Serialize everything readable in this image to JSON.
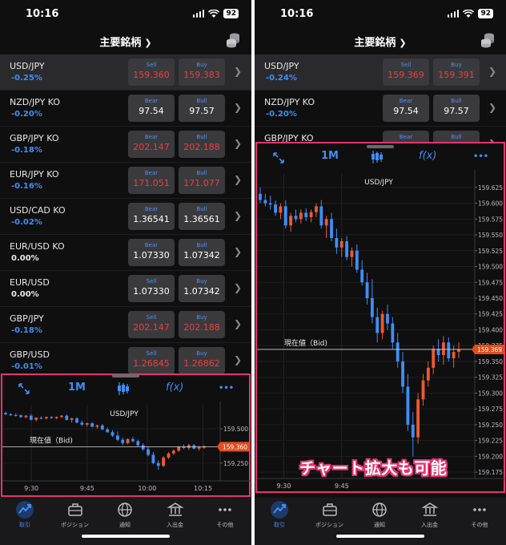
{
  "status": {
    "time": "10:16",
    "battery": "92"
  },
  "nav": {
    "title": "主要銘柄"
  },
  "rates": [
    {
      "pair": "USD/JPY",
      "change": "-0.25%",
      "sign": "neg",
      "b1_label": "Sell",
      "b1_value": "159.360",
      "b2_label": "Buy",
      "b2_value": "159.383",
      "red": true
    },
    {
      "pair": "NZD/JPY KO",
      "change": "-0.20%",
      "sign": "neg",
      "b1_label": "Bear",
      "b1_value": "97.54",
      "b2_label": "Bull",
      "b2_value": "97.57",
      "red": false
    },
    {
      "pair": "GBP/JPY KO",
      "change": "-0.18%",
      "sign": "neg",
      "b1_label": "Bear",
      "b1_value": "202.147",
      "b2_label": "Bull",
      "b2_value": "202.188",
      "red": true
    },
    {
      "pair": "EUR/JPY KO",
      "change": "-0.16%",
      "sign": "neg",
      "b1_label": "Bear",
      "b1_value": "171.051",
      "b2_label": "Bull",
      "b2_value": "171.077",
      "red": true
    },
    {
      "pair": "USD/CAD KO",
      "change": "-0.02%",
      "sign": "neg",
      "b1_label": "Bear",
      "b1_value": "1.36541",
      "b2_label": "Bull",
      "b2_value": "1.36561",
      "red": false
    },
    {
      "pair": "EUR/USD KO",
      "change": "0.00%",
      "sign": "zero",
      "b1_label": "Bear",
      "b1_value": "1.07330",
      "b2_label": "Bull",
      "b2_value": "1.07342",
      "red": false
    },
    {
      "pair": "EUR/USD",
      "change": "0.00%",
      "sign": "zero",
      "b1_label": "Sell",
      "b1_value": "1.07330",
      "b2_label": "Buy",
      "b2_value": "1.07342",
      "red": false
    },
    {
      "pair": "GBP/JPY",
      "change": "-0.18%",
      "sign": "neg",
      "b1_label": "Sell",
      "b1_value": "202.147",
      "b2_label": "Buy",
      "b2_value": "202.188",
      "red": true
    },
    {
      "pair": "GBP/USD",
      "change": "-0.01%",
      "sign": "neg",
      "b1_label": "Sell",
      "b1_value": "1.26845",
      "b2_label": "Buy",
      "b2_value": "1.26862",
      "red": true
    }
  ],
  "rates_right": [
    {
      "pair": "USD/JPY",
      "change": "-0.24%",
      "sign": "neg",
      "b1_label": "Sell",
      "b1_value": "159.369",
      "b2_label": "Buy",
      "b2_value": "159.391",
      "red": true
    },
    {
      "pair": "NZD/JPY KO",
      "change": "-0.20%",
      "sign": "neg",
      "b1_label": "Bear",
      "b1_value": "97.54",
      "b2_label": "Bull",
      "b2_value": "97.57",
      "red": false
    },
    {
      "pair": "GBP/JPY KO",
      "change": "",
      "sign": "neg",
      "b1_label": "Bear",
      "b1_value": "",
      "b2_label": "Bull",
      "b2_value": "",
      "red": true
    }
  ],
  "toolbar": {
    "period": "1M",
    "func": "f(x)",
    "more": "•••"
  },
  "chart_left": {
    "symbol": "USD/JPY",
    "current_label": "現在値（Bid)",
    "current_value": "159.360",
    "y_ticks": [
      "159.500",
      "159.250"
    ],
    "x_ticks": [
      "9:30",
      "9:45",
      "10:00",
      "10:15"
    ]
  },
  "chart_right": {
    "symbol": "USD/JPY",
    "current_label": "現在値（Bid)",
    "current_value": "159.369",
    "y_ticks": [
      "159.625",
      "159.600",
      "159.575",
      "159.550",
      "159.525",
      "159.500",
      "159.475",
      "159.450",
      "159.425",
      "159.400",
      "159.375",
      "159.350",
      "159.325",
      "159.300",
      "159.275",
      "159.250",
      "159.225",
      "159.200",
      "159.175"
    ],
    "x_ticks": [
      "9:30",
      "9:45"
    ]
  },
  "chart_data": {
    "type": "candlestick",
    "title": "USD/JPY",
    "x_ticks": [
      "9:30",
      "9:45",
      "10:00",
      "10:15"
    ],
    "ylim": [
      159.165,
      159.64
    ],
    "current_value": 159.369,
    "candles": [
      [
        159.615,
        159.625,
        159.6,
        159.605
      ],
      [
        159.605,
        159.615,
        159.595,
        159.6
      ],
      [
        159.6,
        159.612,
        159.59,
        159.598
      ],
      [
        159.598,
        159.604,
        159.58,
        159.585
      ],
      [
        159.585,
        159.6,
        159.575,
        159.595
      ],
      [
        159.595,
        159.605,
        159.56,
        159.565
      ],
      [
        159.565,
        159.585,
        159.555,
        159.58
      ],
      [
        159.58,
        159.59,
        159.57,
        159.575
      ],
      [
        159.575,
        159.59,
        159.568,
        159.585
      ],
      [
        159.585,
        159.592,
        159.572,
        159.578
      ],
      [
        159.578,
        159.59,
        159.57,
        159.586
      ],
      [
        159.586,
        159.6,
        159.578,
        159.595
      ],
      [
        159.595,
        159.605,
        159.56,
        159.565
      ],
      [
        159.565,
        159.58,
        159.545,
        159.575
      ],
      [
        159.575,
        159.585,
        159.54,
        159.545
      ],
      [
        159.545,
        159.56,
        159.52,
        159.53
      ],
      [
        159.53,
        159.545,
        159.515,
        159.54
      ],
      [
        159.54,
        159.548,
        159.51,
        159.515
      ],
      [
        159.515,
        159.53,
        159.5,
        159.525
      ],
      [
        159.525,
        159.535,
        159.49,
        159.495
      ],
      [
        159.495,
        159.51,
        159.47,
        159.475
      ],
      [
        159.475,
        159.49,
        159.44,
        159.45
      ],
      [
        159.45,
        159.48,
        159.41,
        159.42
      ],
      [
        159.42,
        159.435,
        159.38,
        159.395
      ],
      [
        159.395,
        159.43,
        159.385,
        159.425
      ],
      [
        159.425,
        159.44,
        159.4,
        159.41
      ],
      [
        159.41,
        159.42,
        159.37,
        159.38
      ],
      [
        159.38,
        159.395,
        159.34,
        159.35
      ],
      [
        159.35,
        159.365,
        159.3,
        159.31
      ],
      [
        159.31,
        159.33,
        159.24,
        159.25
      ],
      [
        159.25,
        159.27,
        159.2,
        159.23
      ],
      [
        159.23,
        159.3,
        159.22,
        159.29
      ],
      [
        159.29,
        159.33,
        159.28,
        159.32
      ],
      [
        159.32,
        159.35,
        159.31,
        159.34
      ],
      [
        159.34,
        159.375,
        159.33,
        159.37
      ],
      [
        159.37,
        159.385,
        159.35,
        159.36
      ],
      [
        159.36,
        159.39,
        159.345,
        159.38
      ],
      [
        159.38,
        159.388,
        159.35,
        159.355
      ],
      [
        159.355,
        159.375,
        159.34,
        159.365
      ],
      [
        159.365,
        159.38,
        159.355,
        159.369
      ]
    ]
  }
}
